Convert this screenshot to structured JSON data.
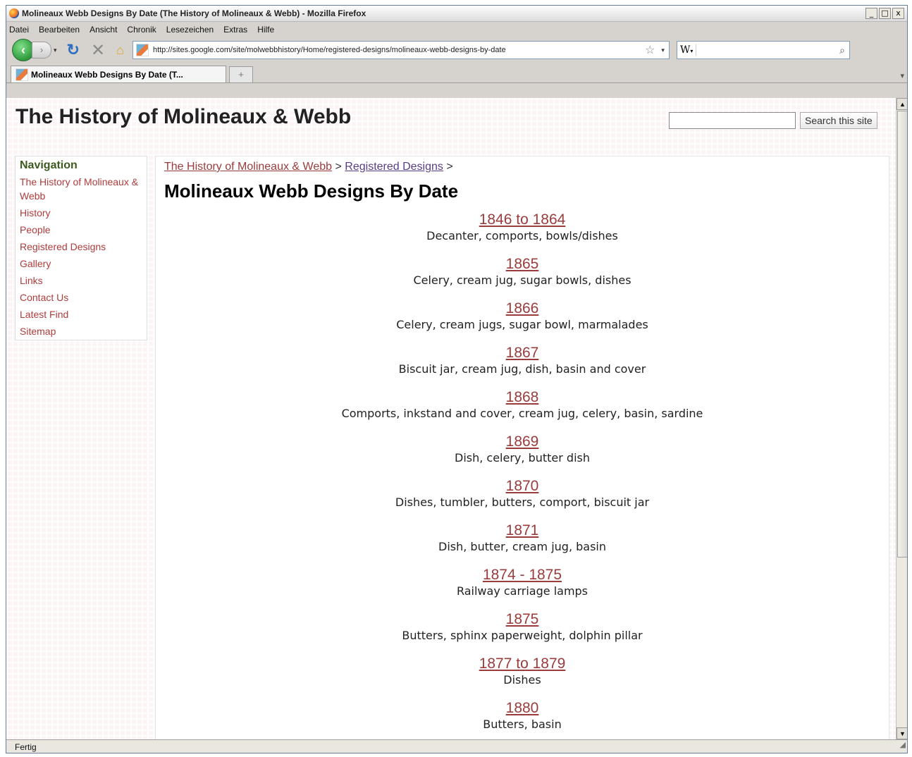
{
  "window": {
    "title": "Molineaux Webb Designs By Date (The History of Molineaux & Webb) - Mozilla Firefox",
    "controls": {
      "minimize": "_",
      "maximize": "□",
      "close": "x"
    }
  },
  "menubar": [
    "Datei",
    "Bearbeiten",
    "Ansicht",
    "Chronik",
    "Lesezeichen",
    "Extras",
    "Hilfe"
  ],
  "navbar": {
    "url": "http://sites.google.com/site/molwebbhistory/Home/registered-designs/molineaux-webb-designs-by-date",
    "search_engine": "W"
  },
  "tabs": [
    {
      "label": "Molineaux Webb Designs By Date (T..."
    }
  ],
  "site": {
    "title": "The History of Molineaux & Webb",
    "search_button": "Search this site"
  },
  "sidebar": {
    "heading": "Navigation",
    "items": [
      {
        "label": "The History of Molineaux & Webb"
      },
      {
        "label": "History"
      },
      {
        "label": "People"
      },
      {
        "label": "Registered Designs"
      },
      {
        "label": "Gallery"
      },
      {
        "label": "Links"
      },
      {
        "label": "Contact Us"
      },
      {
        "label": "Latest Find"
      },
      {
        "label": "Sitemap"
      }
    ]
  },
  "breadcrumb": {
    "items": [
      "The History of Molineaux & Webb",
      "Registered Designs"
    ],
    "separator": ">"
  },
  "page_title": "Molineaux Webb Designs By Date",
  "designs": [
    {
      "period": "1846 to 1864",
      "description": "Decanter, comports, bowls/dishes"
    },
    {
      "period": "1865",
      "description": "Celery, cream jug, sugar bowls, dishes"
    },
    {
      "period": "1866",
      "description": "Celery, cream jugs, sugar bowl, marmalades"
    },
    {
      "period": "1867",
      "description": "Biscuit jar, cream jug, dish, basin and cover"
    },
    {
      "period": "1868",
      "description": "Comports, inkstand and cover, cream jug, celery, basin, sardine"
    },
    {
      "period": "1869",
      "description": "Dish, celery, butter dish"
    },
    {
      "period": "1870",
      "description": "Dishes, tumbler, butters, comport, biscuit jar"
    },
    {
      "period": "1871",
      "description": "Dish, butter, cream jug, basin"
    },
    {
      "period": "1874 - 1875",
      "description": "Railway carriage lamps"
    },
    {
      "period": "1875",
      "description": "Butters, sphinx paperweight, dolphin pillar"
    },
    {
      "period": "1877 to 1879",
      "description": "Dishes"
    },
    {
      "period": "1880",
      "description": "Butters, basin"
    }
  ],
  "statusbar": {
    "text": "Fertig"
  }
}
